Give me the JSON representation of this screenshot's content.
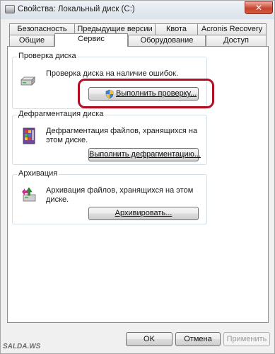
{
  "window": {
    "title": "Свойства: Локальный диск (C:)",
    "close_label": "✕"
  },
  "tabs_row1": [
    {
      "label": "Безопасность"
    },
    {
      "label": "Предыдущие версии"
    },
    {
      "label": "Квота"
    },
    {
      "label": "Acronis Recovery"
    }
  ],
  "tabs_row2": [
    {
      "label": "Общие"
    },
    {
      "label": "Сервис",
      "active": true
    },
    {
      "label": "Оборудование"
    },
    {
      "label": "Доступ"
    }
  ],
  "check": {
    "title": "Проверка диска",
    "description": "Проверка диска на наличие ошибок.",
    "button": "Выполнить проверку...",
    "icon": "drive-icon"
  },
  "defrag": {
    "title": "Дефрагментация диска",
    "description": "Дефрагментация файлов, хранящихся на этом диске.",
    "button": "Выполнить дефрагментацию...",
    "icon": "defrag-icon"
  },
  "backup": {
    "title": "Архивация",
    "description": "Архивация файлов, хранящихся на этом диске.",
    "button": "Архивировать...",
    "icon": "backup-icon"
  },
  "footer": {
    "ok": "OK",
    "cancel": "Отмена",
    "apply": "Применить"
  },
  "watermark": "SALDA.WS",
  "colors": {
    "highlight": "#b01022",
    "close": "#c8432f"
  }
}
